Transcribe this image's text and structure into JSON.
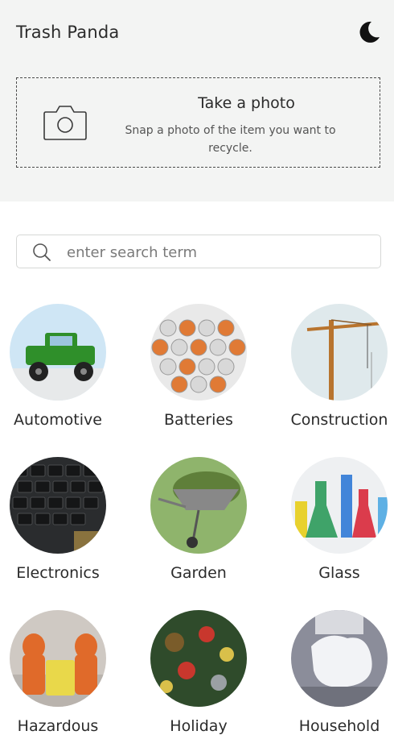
{
  "header": {
    "title": "Trash Panda",
    "theme_icon": "moon-icon"
  },
  "photo_card": {
    "title": "Take a photo",
    "subtitle": "Snap a photo of the item you want to recycle.",
    "icon": "camera-icon"
  },
  "search": {
    "placeholder": "enter search term",
    "value": "",
    "icon": "search-icon"
  },
  "colors": {
    "top_background": "#f3f4f3",
    "text": "#2b2b2b",
    "border": "#d6d8d6"
  },
  "categories": [
    {
      "label": "Automotive"
    },
    {
      "label": "Batteries"
    },
    {
      "label": "Construction"
    },
    {
      "label": "Electronics"
    },
    {
      "label": "Garden"
    },
    {
      "label": "Glass"
    },
    {
      "label": "Hazardous"
    },
    {
      "label": "Holiday"
    },
    {
      "label": "Household"
    }
  ]
}
